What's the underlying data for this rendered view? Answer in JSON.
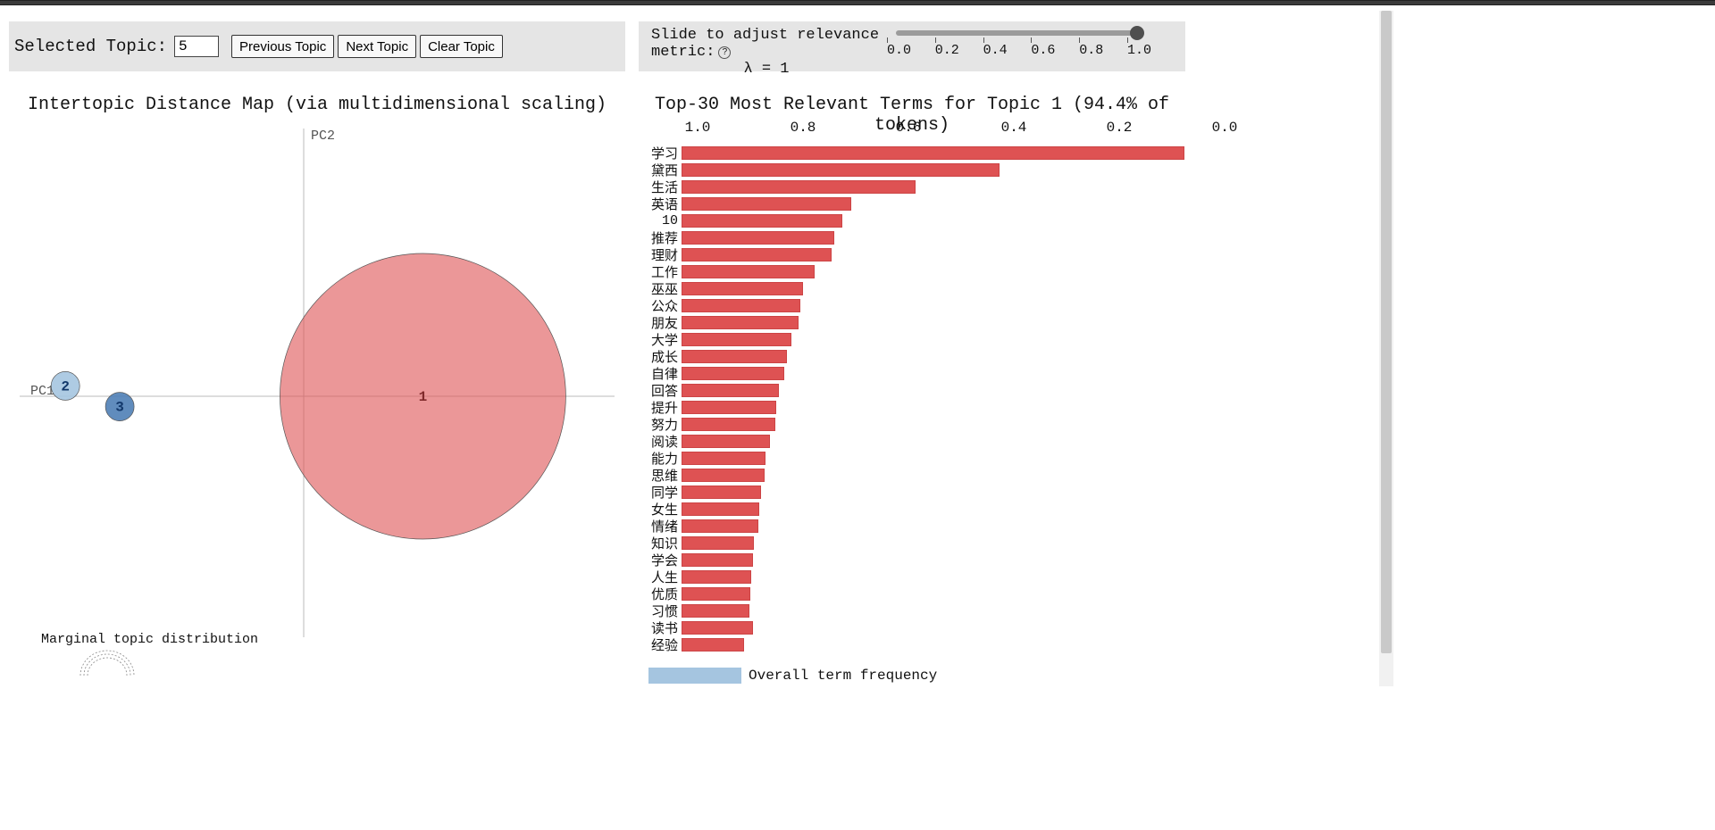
{
  "controls": {
    "selected_topic_label": "Selected Topic:",
    "selected_topic_value": "5",
    "prev_btn": "Previous Topic",
    "next_btn": "Next Topic",
    "clear_btn": "Clear Topic",
    "slider_label_line1": "Slide to adjust relevance",
    "slider_label_line2": "metric:",
    "slider_help": "?",
    "lambda_line": "λ = 1",
    "slider_ticks": [
      "0.0",
      "0.2",
      "0.4",
      "0.6",
      "0.8",
      "1.0"
    ],
    "slider_value": 1.0
  },
  "left_chart": {
    "title": "Intertopic Distance Map (via multidimensional scaling)",
    "pc1_label": "PC1",
    "pc2_label": "PC2",
    "marginal_title": "Marginal topic distribution"
  },
  "right_chart": {
    "title": "Top-30 Most Relevant Terms for Topic 1 (94.4% of tokens)",
    "legend_label": "Overall term frequency"
  },
  "chart_data": [
    {
      "type": "bubble",
      "name": "intertopic_distance_map",
      "x_axis": "PC1",
      "y_axis": "PC2",
      "topics": [
        {
          "id": 1,
          "x": 0.46,
          "y": 0.0,
          "radius_rel": 1.0,
          "color": "#de5253",
          "opacity": 0.6
        },
        {
          "id": 2,
          "x": -0.92,
          "y": 0.04,
          "radius_rel": 0.1,
          "color": "#a5c5e0",
          "opacity": 0.9
        },
        {
          "id": 3,
          "x": -0.71,
          "y": -0.04,
          "radius_rel": 0.1,
          "color": "#4f7fb6",
          "opacity": 0.9
        }
      ],
      "x_range": [
        -1,
        1
      ],
      "y_range": [
        -1,
        1
      ]
    },
    {
      "type": "bar",
      "name": "top30_terms_topic1",
      "orientation": "horizontal",
      "xlabel": "",
      "ylabel": "",
      "x_ticks": [
        1.0,
        0.8,
        0.6,
        0.4,
        0.2,
        0.0
      ],
      "x_range": [
        1.0,
        0.0
      ],
      "categories": [
        "学习",
        "黛西",
        "生活",
        "英语",
        "10",
        "推荐",
        "理财",
        "工作",
        "巫巫",
        "公众",
        "朋友",
        "大学",
        "成长",
        "自律",
        "回答",
        "提升",
        "努力",
        "阅读",
        "能力",
        "思维",
        "同学",
        "女生",
        "情绪",
        "知识",
        "学会",
        "人生",
        "优质",
        "习惯",
        "读书",
        "经验"
      ],
      "values": [
        0.955,
        0.603,
        0.444,
        0.322,
        0.305,
        0.29,
        0.285,
        0.252,
        0.23,
        0.225,
        0.222,
        0.208,
        0.2,
        0.195,
        0.185,
        0.18,
        0.178,
        0.168,
        0.16,
        0.158,
        0.15,
        0.148,
        0.145,
        0.138,
        0.135,
        0.132,
        0.13,
        0.128,
        0.135,
        0.118
      ],
      "bar_color": "#de5253"
    }
  ]
}
